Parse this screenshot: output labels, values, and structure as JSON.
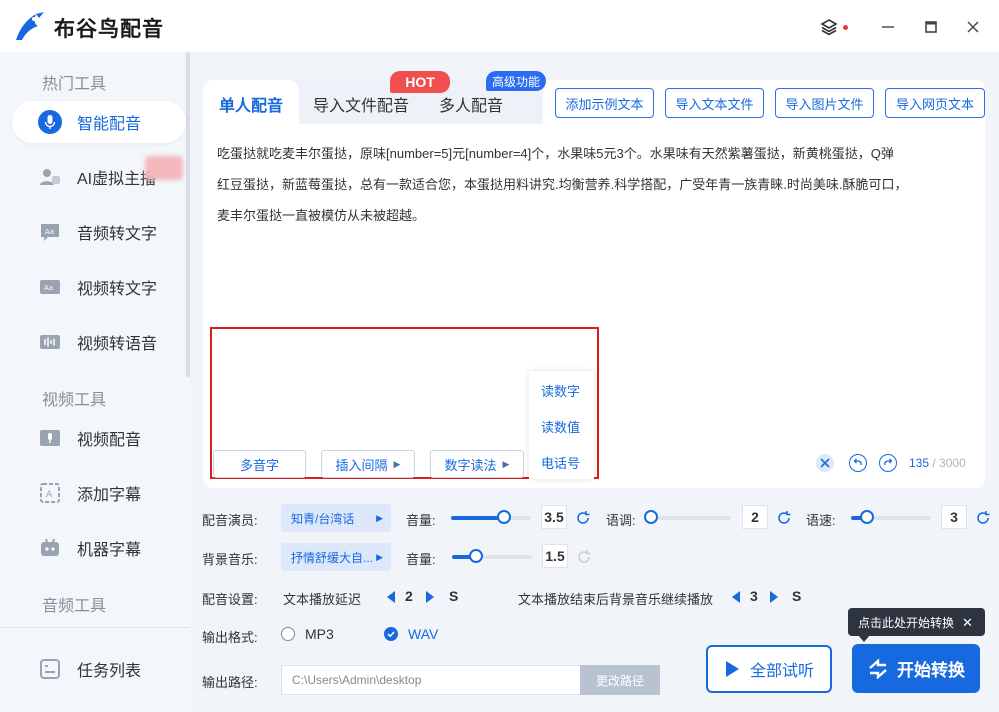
{
  "app": {
    "title": "布谷鸟配音"
  },
  "window_controls": {
    "layers_icon": "layers-icon",
    "minimize": "—",
    "close": "✕"
  },
  "sidebar": {
    "sections": [
      "热门工具",
      "视频工具",
      "音频工具"
    ],
    "items": [
      {
        "label": "智能配音",
        "icon": "mic-icon",
        "active": true
      },
      {
        "label": "AI虚拟主播",
        "icon": "avatar-icon"
      },
      {
        "label": "音频转文字",
        "icon": "audio-text-icon"
      },
      {
        "label": "视频转文字",
        "icon": "video-text-icon"
      },
      {
        "label": "视频转语音",
        "icon": "waveform-icon"
      },
      {
        "label": "视频配音",
        "icon": "video-mic-icon"
      },
      {
        "label": "添加字幕",
        "icon": "subtitle-icon"
      },
      {
        "label": "机器字幕",
        "icon": "robot-icon"
      }
    ],
    "task_list": "任务列表"
  },
  "tabs": [
    {
      "label": "单人配音",
      "active": true
    },
    {
      "label": "导入文件配音"
    },
    {
      "label": "多人配音"
    }
  ],
  "badges": {
    "hot": "HOT",
    "advanced": "高级功能"
  },
  "top_buttons": [
    "添加示例文本",
    "导入文本文件",
    "导入图片文件",
    "导入网页文本"
  ],
  "content": {
    "text_lines": [
      "吃蛋挞就吃麦丰尔蛋挞，原味[number=5]元[number=4]个，水果味5元3个。水果味有天然紫薯蛋挞，新黄桃蛋挞，Q弹",
      "红豆蛋挞，新蓝莓蛋挞，总有一款适合您，本蛋挞用料讲究.均衡营养.科学搭配，广受年青一族青睐.时尚美味.酥脆可口，",
      "麦丰尔蛋挞一直被模仿从未被超越。"
    ]
  },
  "toolbar": {
    "polyphone": "多音字",
    "insert_pause": "插入间隔",
    "number_reading": "数字读法"
  },
  "number_popup": [
    "读数字",
    "读数值",
    "电话号"
  ],
  "counter": {
    "current": "135",
    "max": "/ 3000"
  },
  "settings": {
    "voice_actor_label": "配音演员:",
    "voice_actor": "知青/台湾话",
    "volume_label": "音量:",
    "volume_value": "3.5",
    "volume_level": 0.66,
    "pitch_label": "语调:",
    "pitch_value": "2",
    "pitch_level": 0.0,
    "speed_label": "语速:",
    "speed_value": "3",
    "speed_level": 0.2,
    "bgm_label": "背景音乐:",
    "bgm": "抒情舒缓大自...",
    "bgm_volume_label": "音量:",
    "bgm_volume_value": "1.5",
    "bgm_volume_level": 0.3,
    "dub_settings_label": "配音设置:",
    "delay_label": "文本播放延迟",
    "delay_value": "2",
    "unit_s": "S",
    "bgm_continue_label": "文本播放结束后背景音乐继续播放",
    "bgm_continue_value": "3",
    "format_label": "输出格式:",
    "format_mp3": "MP3",
    "format_wav": "WAV",
    "format_selected": "WAV",
    "path_label": "输出路径:",
    "path_value": "C:\\Users\\Admin\\desktop",
    "change_path": "更改路径"
  },
  "actions": {
    "preview_all": "全部试听",
    "start_convert": "开始转换",
    "tooltip": "点击此处开始转换"
  },
  "colors": {
    "accent": "#1769e0",
    "hot": "#ef4f4f",
    "highlight_box": "#d81e1e"
  }
}
